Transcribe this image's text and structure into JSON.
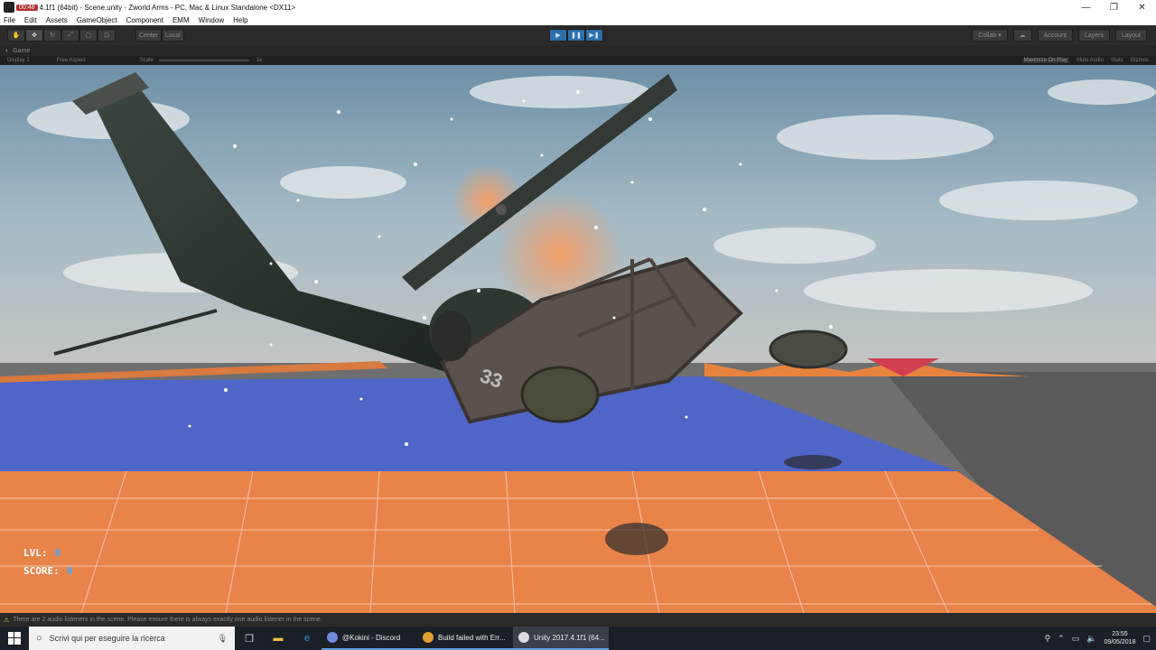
{
  "window": {
    "recording_badge": "00:48",
    "title": "4.1f1 (64bit) - Scene.unity - Zworld Arms - PC, Mac & Linux Standalone <DX11>",
    "minimize": "—",
    "maximize": "❐",
    "close": "✕"
  },
  "menu": [
    "File",
    "Edit",
    "Assets",
    "GameObject",
    "Component",
    "EMM",
    "Window",
    "Help"
  ],
  "toolbar": {
    "pivot": "Center",
    "space": "Local",
    "collab": "Collab ▾",
    "account": "Account",
    "layers": "Layers",
    "layout": "Layout"
  },
  "game_tab": {
    "label": "Game",
    "display": "Display 1",
    "aspect": "Free Aspect",
    "scale_label": "Scale",
    "scale_value": "1x",
    "maximize_on_play": "Maximize On Play",
    "mute_audio": "Mute Audio",
    "stats": "Stats",
    "gizmos": "Gizmos"
  },
  "hud": {
    "lvl_label": "LVL:",
    "lvl_value": "0",
    "score_label": "SCORE:",
    "score_value": "0"
  },
  "vehicle_number": "33",
  "status": {
    "message": "There are 2 audio listeners in the scene. Please ensure there is always exactly one audio listener in the scene."
  },
  "taskbar": {
    "search_placeholder": "Scrivi qui per eseguire la ricerca",
    "tasks": [
      {
        "label": "@Kokini - Discord",
        "color": "#7289da"
      },
      {
        "label": "Build failed with Err...",
        "color": "#e0a030"
      },
      {
        "label": "Unity 2017.4.1f1 (64...",
        "color": "#dddddd"
      }
    ],
    "time": "23:55",
    "date": "09/05/2018"
  }
}
